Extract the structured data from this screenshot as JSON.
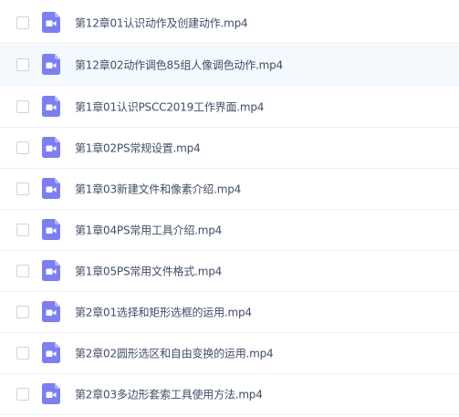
{
  "files": [
    {
      "name": "第12章01认识动作及创建动作.mp4",
      "icon": "video-file-icon",
      "hovered": false
    },
    {
      "name": "第12章02动作调色85组人像调色动作.mp4",
      "icon": "video-file-icon",
      "hovered": true
    },
    {
      "name": "第1章01认识PSCC2019工作界面.mp4",
      "icon": "video-file-icon",
      "hovered": false
    },
    {
      "name": "第1章02PS常规设置.mp4",
      "icon": "video-file-icon",
      "hovered": false
    },
    {
      "name": "第1章03新建文件和像素介绍.mp4",
      "icon": "video-file-icon",
      "hovered": false
    },
    {
      "name": "第1章04PS常用工具介绍.mp4",
      "icon": "video-file-icon",
      "hovered": false
    },
    {
      "name": "第1章05PS常用文件格式.mp4",
      "icon": "video-file-icon",
      "hovered": false
    },
    {
      "name": "第2章01选择和矩形选框的运用.mp4",
      "icon": "video-file-icon",
      "hovered": false
    },
    {
      "name": "第2章02圆形选区和自由变换的运用.mp4",
      "icon": "video-file-icon",
      "hovered": false
    },
    {
      "name": "第2章03多边形套索工具使用方法.mp4",
      "icon": "video-file-icon",
      "hovered": false
    }
  ],
  "colors": {
    "icon_fill": "#7d7ff0",
    "text": "#424e67",
    "hover_bg": "#f4f9fd",
    "divider": "#eef1f5"
  }
}
